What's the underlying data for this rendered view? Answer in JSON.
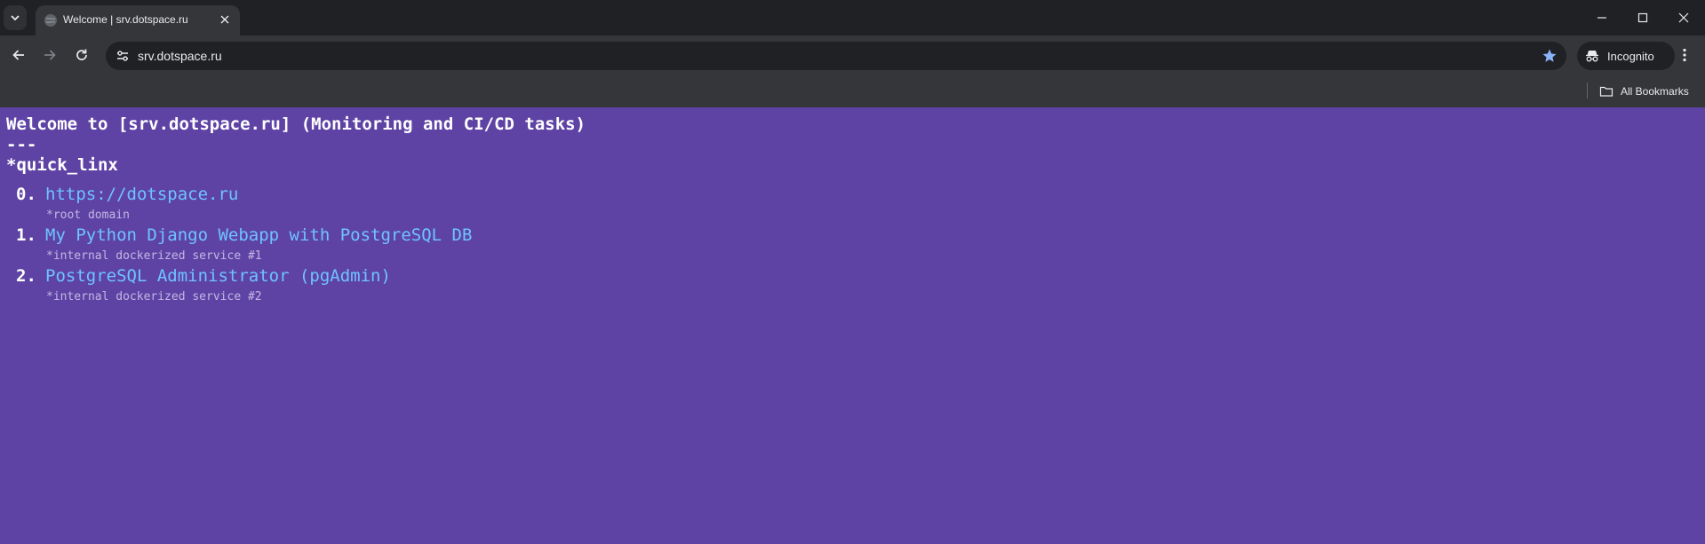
{
  "browser": {
    "tab": {
      "title": "Welcome | srv.dotspace.ru"
    },
    "address_bar": {
      "url": "srv.dotspace.ru"
    },
    "profile_label": "Incognito",
    "bookmarks": {
      "all_label": "All Bookmarks"
    }
  },
  "page": {
    "heading": "Welcome to [srv.dotspace.ru] (Monitoring and CI/CD tasks)",
    "separator": "---",
    "section_title": "*quick_linx",
    "links": [
      {
        "number": "0.",
        "label": "https://dotspace.ru",
        "description": "*root domain"
      },
      {
        "number": "1.",
        "label": "My Python Django Webapp with PostgreSQL DB",
        "description": "*internal dockerized service #1"
      },
      {
        "number": "2.",
        "label": "PostgreSQL Administrator (pgAdmin)",
        "description": "*internal dockerized service #2"
      }
    ]
  },
  "colors": {
    "page_background": "#5e43a5",
    "link": "#6fc3ff",
    "chrome_dark": "#202124",
    "chrome_toolbar": "#35363a",
    "star_accent": "#8ab4f8"
  }
}
